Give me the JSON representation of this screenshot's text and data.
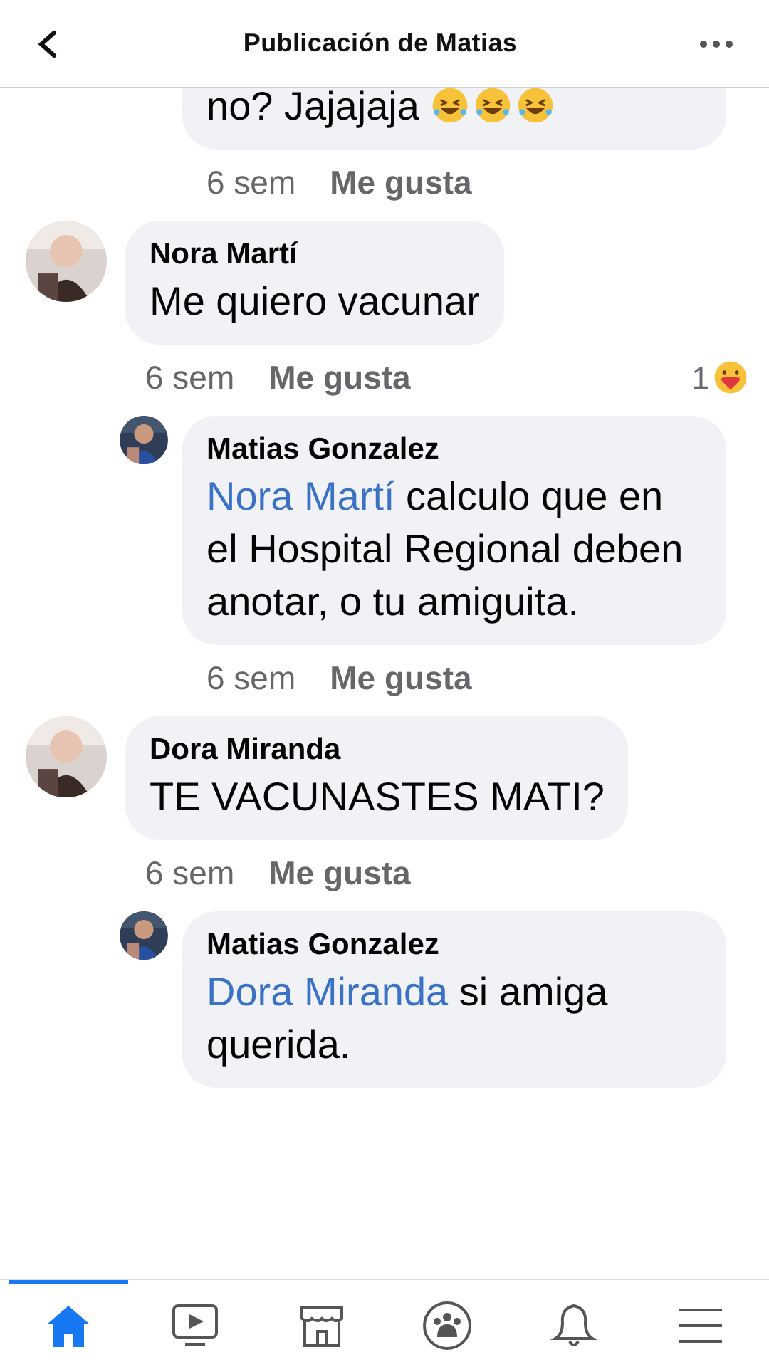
{
  "header": {
    "title": "Publicación de Matias"
  },
  "comments": [
    {
      "kind": "reply",
      "text": "no? Jajajaja",
      "emojis": [
        {
          "kind": "laughing"
        },
        {
          "kind": "laughing"
        },
        {
          "kind": "laughing"
        }
      ],
      "time": "6 sem",
      "like": "Me gusta"
    },
    {
      "kind": "top",
      "author": "Nora Martí",
      "text": "Me quiero vacunar",
      "time": "6 sem",
      "like": "Me gusta",
      "reactions": "1"
    },
    {
      "kind": "reply",
      "author": "Matias Gonzalez",
      "mention": "Nora Martí",
      "text": " calculo que en el Hospital Regional deben anotar, o tu amiguita.",
      "time": "6 sem",
      "like": "Me gusta"
    },
    {
      "kind": "top",
      "author": "Dora Miranda",
      "text": "TE VACUNASTES MATI?",
      "time": "6 sem",
      "like": "Me gusta"
    },
    {
      "kind": "reply",
      "author": "Matias Gonzalez",
      "mention": "Dora Miranda",
      "text": " si amiga querida."
    }
  ],
  "tabbar": [
    {
      "selected": true
    },
    {
      "selected": false
    },
    {
      "selected": false
    },
    {
      "selected": false
    },
    {
      "selected": false
    },
    {
      "selected": false
    }
  ]
}
